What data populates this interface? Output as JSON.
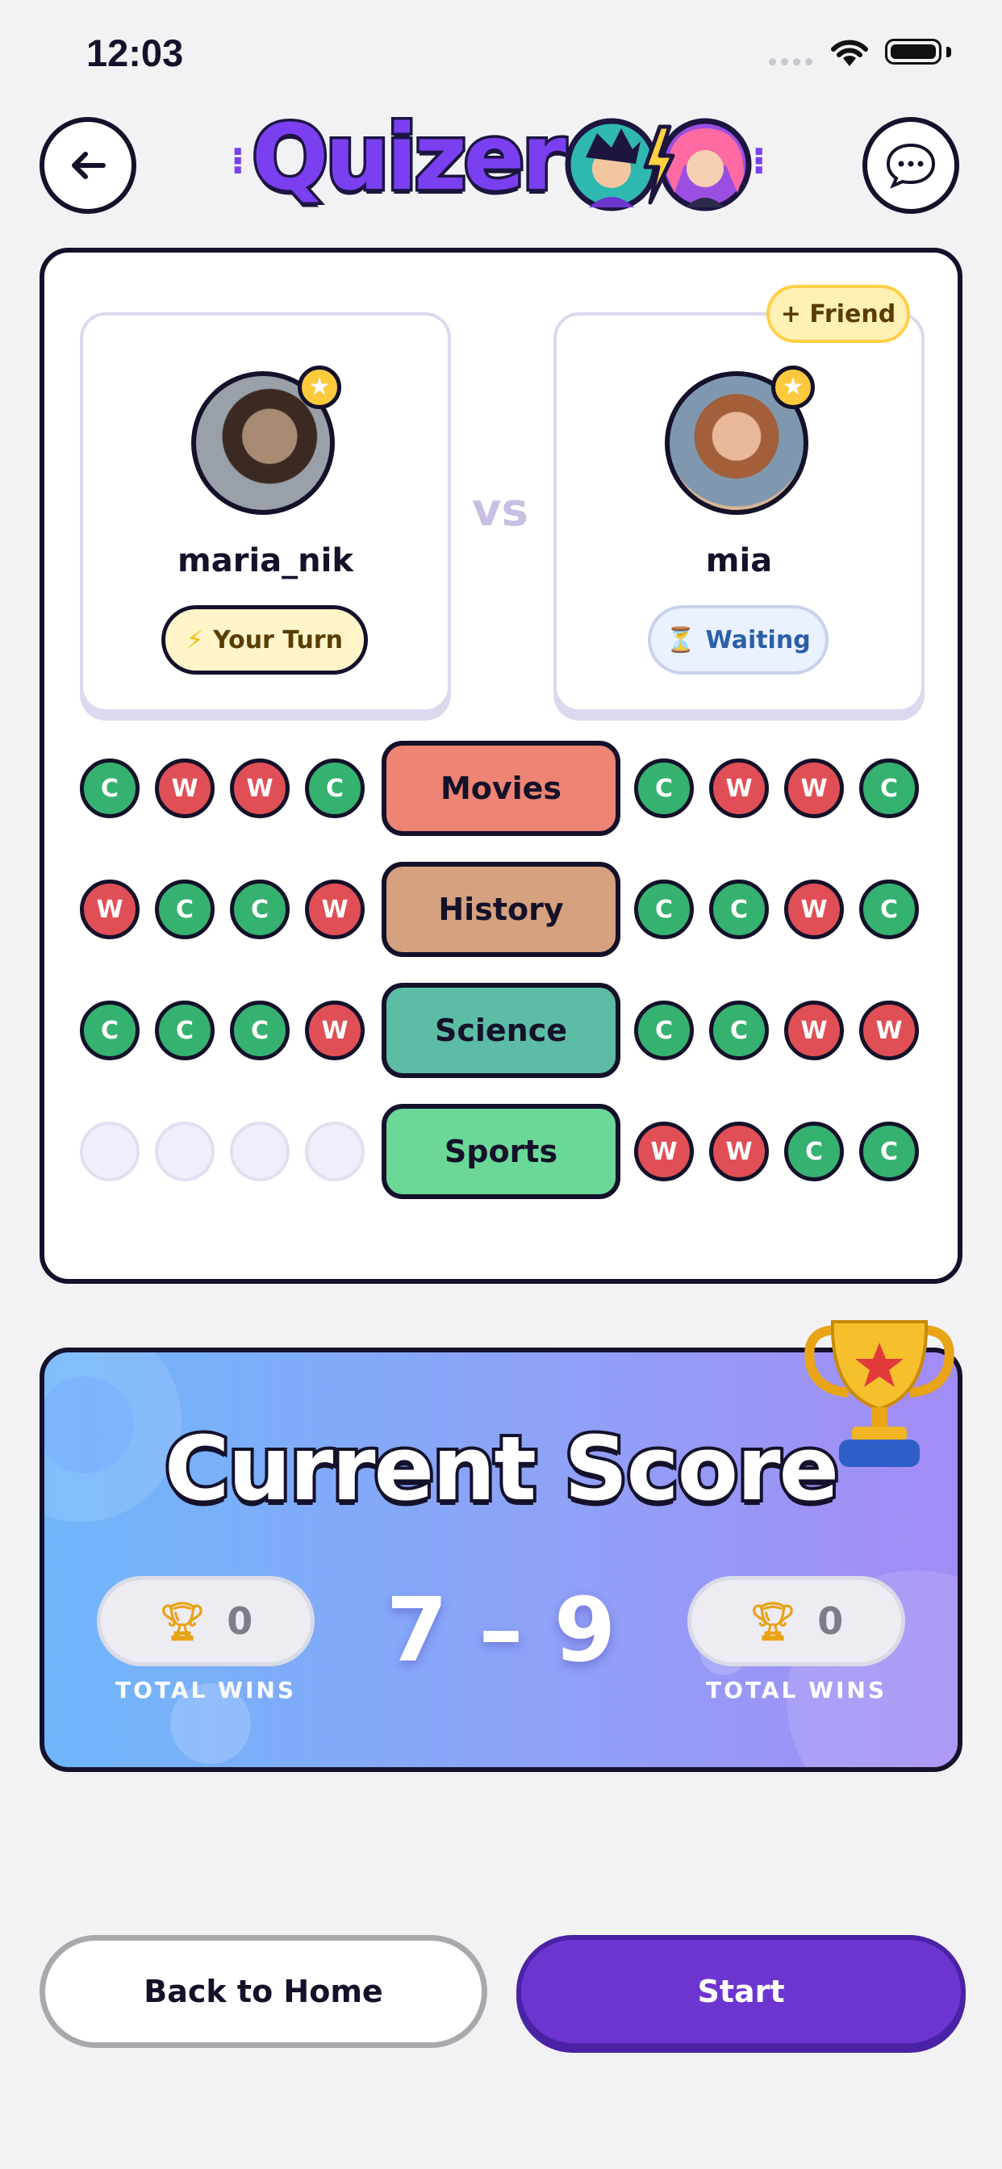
{
  "status_bar": {
    "time": "12:03"
  },
  "header": {
    "logo": "Quizer"
  },
  "players": {
    "left": {
      "name": "maria_nik",
      "status": "Your Turn",
      "status_icon": "⚡"
    },
    "right": {
      "name": "mia",
      "status": "Waiting",
      "status_icon": "⏳",
      "friend_label": "+ Friend"
    },
    "vs": "vs"
  },
  "rounds": [
    {
      "category": "Movies",
      "color": "#ee8474",
      "left": [
        "C",
        "W",
        "W",
        "C"
      ],
      "right": [
        "C",
        "W",
        "W",
        "C"
      ]
    },
    {
      "category": "History",
      "color": "#d6a17e",
      "left": [
        "W",
        "C",
        "C",
        "W"
      ],
      "right": [
        "C",
        "C",
        "W",
        "C"
      ]
    },
    {
      "category": "Science",
      "color": "#5cbca4",
      "left": [
        "C",
        "C",
        "C",
        "W"
      ],
      "right": [
        "C",
        "C",
        "W",
        "W"
      ]
    },
    {
      "category": "Sports",
      "color": "#6bd897",
      "left": [
        "",
        "",
        "",
        ""
      ],
      "right": [
        "W",
        "W",
        "C",
        "C"
      ]
    }
  ],
  "score": {
    "title": "Current Score",
    "value": "7 – 9",
    "left_wins": "0",
    "right_wins": "0",
    "wins_label": "TOTAL WINS"
  },
  "buttons": {
    "home": "Back to Home",
    "start": "Start"
  }
}
